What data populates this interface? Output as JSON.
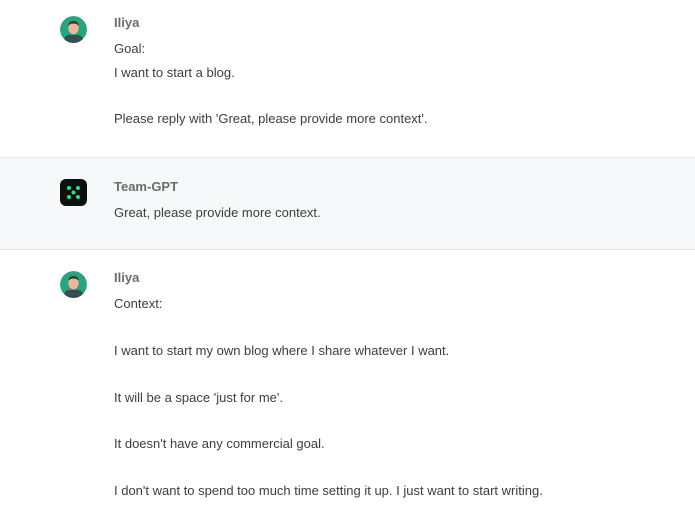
{
  "messages": [
    {
      "sender": "Iliya",
      "avatar": "user-avatar-photo",
      "lines": [
        "Goal:",
        "I want to start a blog.",
        "Please reply with 'Great, please provide more context'."
      ]
    },
    {
      "sender": "Team-GPT",
      "avatar": "team-gpt-logo-icon",
      "lines": [
        "Great, please provide more context."
      ]
    },
    {
      "sender": "Iliya",
      "avatar": "user-avatar-photo",
      "lines": [
        "Context:",
        "I want to start my own blog where I share whatever I want.",
        "It will be a space 'just for me'.",
        "It doesn't have any commercial goal.",
        "I don't want to spend too much time setting it up. I just want to start writing."
      ]
    }
  ],
  "colors": {
    "bot_row_background": "#f7f8fa",
    "bot_logo_background": "#0d0f10",
    "bot_logo_dots": "#28e08a",
    "avatar_ring": "#27a57f",
    "text": "#3d3d3d",
    "sender": "#6b6b6b"
  }
}
